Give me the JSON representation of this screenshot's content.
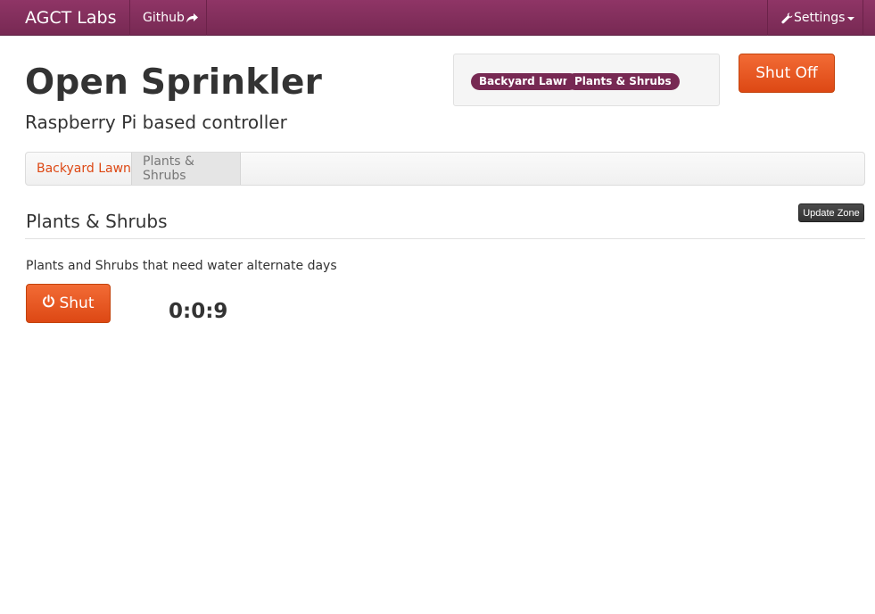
{
  "navbar": {
    "brand": "AGCT Labs",
    "github_label": "Github",
    "github_icon": "share-arrow-icon",
    "settings_label": "Settings",
    "settings_icon": "wrench-icon",
    "bar_color": "#772953"
  },
  "header": {
    "title": "Open Sprinkler",
    "subtitle": "Raspberry Pi based controller"
  },
  "active_zones": {
    "badges": [
      "Backyard Lawn",
      "Plants & Shrubs"
    ]
  },
  "shut_off_label": "Shut Off",
  "accent_color": "#dd4814",
  "tabs": [
    {
      "label": "Backyard Lawn",
      "active": false
    },
    {
      "label": "Plants & Shrubs",
      "active": true
    }
  ],
  "zone": {
    "title": "Plants & Shrubs",
    "update_label": "Update Zone",
    "description": "Plants and Shrubs that need water alternate days",
    "shut_label": "Shut",
    "shut_icon": "power-icon",
    "timer": "0:0:9"
  }
}
